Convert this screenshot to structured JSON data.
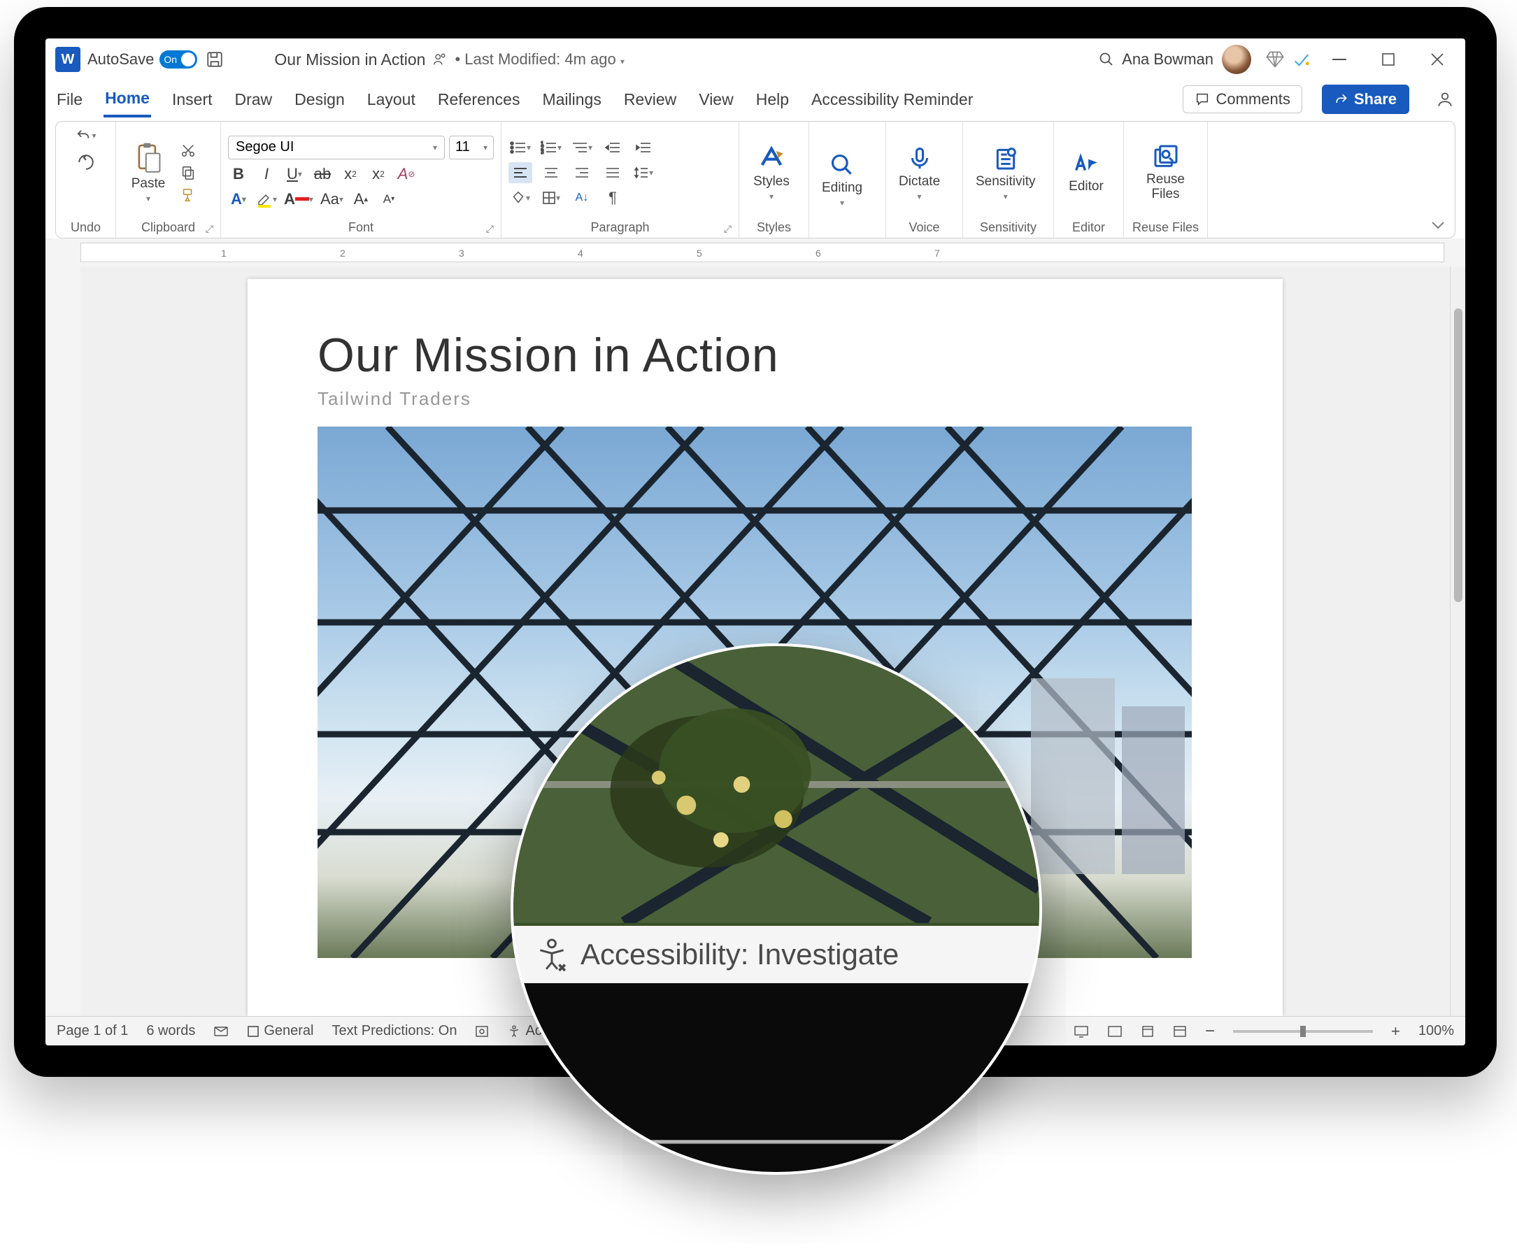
{
  "titlebar": {
    "autosave_label": "AutoSave",
    "autosave_on": "On",
    "doc_title": "Our Mission in Action",
    "modified": "Last Modified: 4m ago",
    "user_name": "Ana Bowman"
  },
  "tabs": {
    "file": "File",
    "home": "Home",
    "insert": "Insert",
    "draw": "Draw",
    "design": "Design",
    "layout": "Layout",
    "references": "References",
    "mailings": "Mailings",
    "review": "Review",
    "view": "View",
    "help": "Help",
    "accessibility_reminder": "Accessibility Reminder",
    "comments": "Comments",
    "share": "Share"
  },
  "ribbon": {
    "undo_label": "Undo",
    "clipboard_label": "Clipboard",
    "paste": "Paste",
    "font_label": "Font",
    "font_name": "Segoe UI",
    "font_size": "11",
    "paragraph_label": "Paragraph",
    "styles_label": "Styles",
    "styles": "Styles",
    "editing": "Editing",
    "dictate": "Dictate",
    "voice_label": "Voice",
    "sensitivity": "Sensitivity",
    "sensitivity_label": "Sensitivity",
    "editor": "Editor",
    "editor_label": "Editor",
    "reuse_files": "Reuse Files",
    "reuse_files_label": "Reuse Files"
  },
  "ruler": {
    "marks": [
      "1",
      "2",
      "3",
      "4",
      "5",
      "6",
      "7"
    ]
  },
  "document": {
    "heading": "Our Mission in Action",
    "subheading": "Tailwind Traders"
  },
  "statusbar": {
    "page": "Page 1 of 1",
    "words": "6 words",
    "general": "General",
    "text_predictions": "Text Predictions: On",
    "accessibility_short": "Acc",
    "zoom": "100%"
  },
  "magnifier": {
    "accessibility": "Accessibility: Investigate"
  }
}
